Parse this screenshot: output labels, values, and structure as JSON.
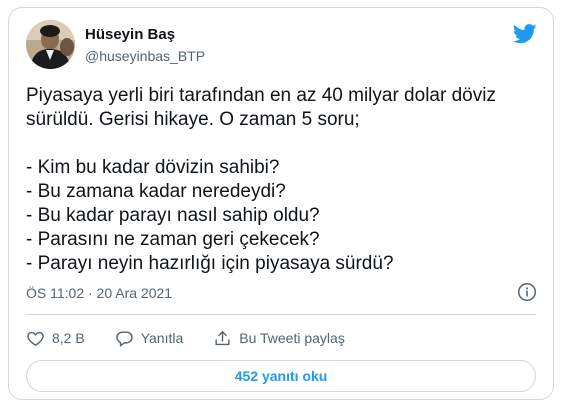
{
  "author": {
    "display_name": "Hüseyin Baş",
    "handle": "@huseyinbas_BTP"
  },
  "tweet": {
    "lines": [
      "Piyasaya yerli biri tarafından en az 40 milyar dolar döviz",
      "sürüldü. Gerisi hikaye. O zaman 5 soru;",
      "",
      "- Kim bu kadar dövizin sahibi?",
      "- Bu zamana kadar neredeydi?",
      "- Bu kadar parayı nasıl sahip oldu?",
      "- Parasını ne zaman geri çekecek?",
      "- Parayı neyin hazırlığı için piyasaya sürdü?"
    ],
    "timestamp": "ÖS 11:02 · 20 Ara 2021"
  },
  "actions": {
    "like_count": "8,2 B",
    "reply_label": "Yanıtla",
    "share_label": "Bu Tweeti paylaş"
  },
  "replies_button": "452 yanıtı oku",
  "icons": {
    "logo": "twitter-bird-icon",
    "info": "info-icon",
    "like": "heart-icon",
    "reply": "speech-bubble-icon",
    "share": "share-icon"
  },
  "colors": {
    "brand_blue": "#1d9bf0",
    "text": "#0f1419",
    "muted": "#536471",
    "border": "#cfd9de"
  }
}
